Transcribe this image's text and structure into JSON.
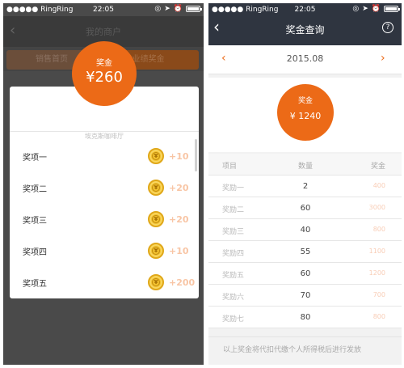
{
  "left": {
    "status": {
      "carrier": "●●●●● RingRing",
      "time": "22:05"
    },
    "navbar": {
      "title": "我的商户"
    },
    "tabs": [
      "销售首页",
      "业绩奖金"
    ],
    "popup": {
      "circle_label": "奖金",
      "circle_amount": "¥260",
      "subtitle": "埃克斯咖啡厅",
      "awards": [
        {
          "label": "奖项一",
          "amount": "+10"
        },
        {
          "label": "奖项二",
          "amount": "+20"
        },
        {
          "label": "奖项三",
          "amount": "+20"
        },
        {
          "label": "奖项四",
          "amount": "+10"
        },
        {
          "label": "奖项五",
          "amount": "+200"
        }
      ],
      "coin_glyph": "¥"
    }
  },
  "right": {
    "status": {
      "carrier": "●●●●● RingRing",
      "time": "22:05"
    },
    "navbar": {
      "title": "奖金查询",
      "back": "‹",
      "help": "?"
    },
    "date": {
      "prev": "‹",
      "value": "2015.08",
      "next": "›"
    },
    "circle": {
      "label": "奖金",
      "amount": "¥ 1240"
    },
    "table": {
      "headers": [
        "项目",
        "数量",
        "奖金"
      ],
      "rows": [
        {
          "item": "奖励一",
          "qty": "2",
          "bonus": "400"
        },
        {
          "item": "奖励二",
          "qty": "60",
          "bonus": "3000"
        },
        {
          "item": "奖励三",
          "qty": "40",
          "bonus": "800"
        },
        {
          "item": "奖励四",
          "qty": "55",
          "bonus": "1100"
        },
        {
          "item": "奖励五",
          "qty": "60",
          "bonus": "1200"
        },
        {
          "item": "奖励六",
          "qty": "70",
          "bonus": "700"
        },
        {
          "item": "奖励七",
          "qty": "80",
          "bonus": "800"
        }
      ]
    },
    "footer": "以上奖金将代扣代缴个人所得税后进行发放"
  },
  "colors": {
    "accent": "#ec6a17",
    "navbar": "#2f3540",
    "coin": "#f2c12e"
  }
}
